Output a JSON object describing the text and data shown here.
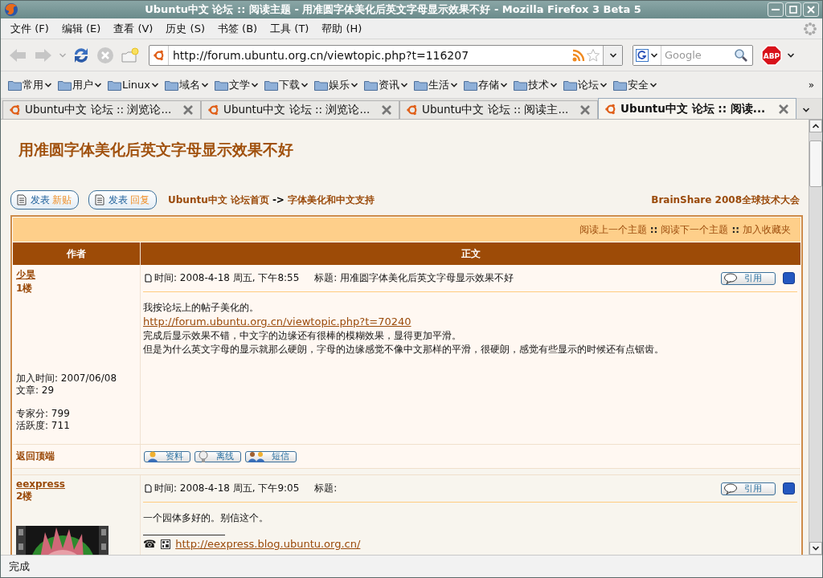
{
  "window": {
    "title": "Ubuntu中文 论坛 :: 阅读主题 - 用准圆字体美化后英文字母显示效果不好 - Mozilla Firefox 3 Beta 5"
  },
  "menu_bar": [
    "文件 (F)",
    "编辑 (E)",
    "查看 (V)",
    "历史 (S)",
    "书签 (B)",
    "工具 (T)",
    "帮助 (H)"
  ],
  "navigation": {
    "address": "http://forum.ubuntu.org.cn/viewtopic.php?t=116207",
    "search_placeholder": "Google",
    "adblock": "ABP"
  },
  "bookmarks": {
    "items": [
      "常用",
      "用户",
      "Linux",
      "域名",
      "文学",
      "下载",
      "娱乐",
      "资讯",
      "生活",
      "存储",
      "技术",
      "论坛",
      "安全"
    ],
    "overflow": "»"
  },
  "tabs": [
    {
      "label": "Ubuntu中文 论坛 :: 浏览论...",
      "selected": false
    },
    {
      "label": "Ubuntu中文 论坛 :: 浏览论...",
      "selected": false
    },
    {
      "label": "Ubuntu中文 论坛 :: 阅读主...",
      "selected": false
    },
    {
      "label": "Ubuntu中文 论坛 :: 阅读...",
      "selected": true
    }
  ],
  "page": {
    "title": "用准圆字体美化后英文字母显示效果不好",
    "buttons": [
      {
        "prefix": "发表",
        "accent": "新贴"
      },
      {
        "prefix": "发表",
        "accent": "回复"
      }
    ],
    "breadcrumb": {
      "items": [
        "Ubuntu中文 论坛首页",
        "字体美化和中文支持"
      ],
      "separator": "->"
    },
    "ad_link": "BrainShare 2008全球技术大会",
    "topic_nav": [
      {
        "kind": "link",
        "text": "阅读上一个主题"
      },
      {
        "kind": "sep",
        "text": "::"
      },
      {
        "kind": "link",
        "text": "阅读下一个主题"
      },
      {
        "kind": "sep",
        "text": "::"
      },
      {
        "kind": "link",
        "text": "加入收藏夹"
      }
    ],
    "table": {
      "columns": [
        "作者",
        "正文"
      ],
      "posts": [
        {
          "author": "少昊",
          "floor": "1楼",
          "info": [
            [
              "加入时间: 2007/06/08",
              "文章: 29"
            ],
            [
              "专家分: 799",
              "活跃度: 711"
            ]
          ],
          "time": "时间: 2008-4-18 周五, 下午8:55",
          "subject": "标题: 用准圆字体美化后英文字母显示效果不好",
          "quote": "引用",
          "body": [
            {
              "kind": "text",
              "text": "我按论坛上的帖子美化的。"
            },
            {
              "kind": "link",
              "text": "http://forum.ubuntu.org.cn/viewtopic.php?t=70240"
            },
            {
              "kind": "text",
              "text": "完成后显示效果不错，中文字的边缘还有很棒的模糊效果，显得更加平滑。"
            },
            {
              "kind": "text",
              "text": "但是为什么英文字母的显示就那么硬朗，字母的边缘感觉不像中文那样的平滑，很硬朗，感觉有些显示的时候还有点锯齿。"
            }
          ],
          "footer": {
            "back_to_top": "返回顶端",
            "actions": [
              {
                "kind": "profile",
                "label": "资料"
              },
              {
                "kind": "status",
                "label": "离线"
              },
              {
                "kind": "message",
                "label": "短信"
              }
            ]
          }
        },
        {
          "author": "eexpress",
          "floor": "2楼",
          "avatar": {
            "kind": "picture"
          },
          "time": "时间: 2008-4-18 周五, 下午9:05",
          "subject": "标题:",
          "quote": "引用",
          "body": [
            {
              "kind": "text",
              "text": "一个园体多好的。别信这个。"
            }
          ],
          "signature": {
            "phone": "☎",
            "link": "http://eexpress.blog.ubuntu.org.cn/"
          }
        }
      ]
    }
  },
  "status_bar": "完成"
}
